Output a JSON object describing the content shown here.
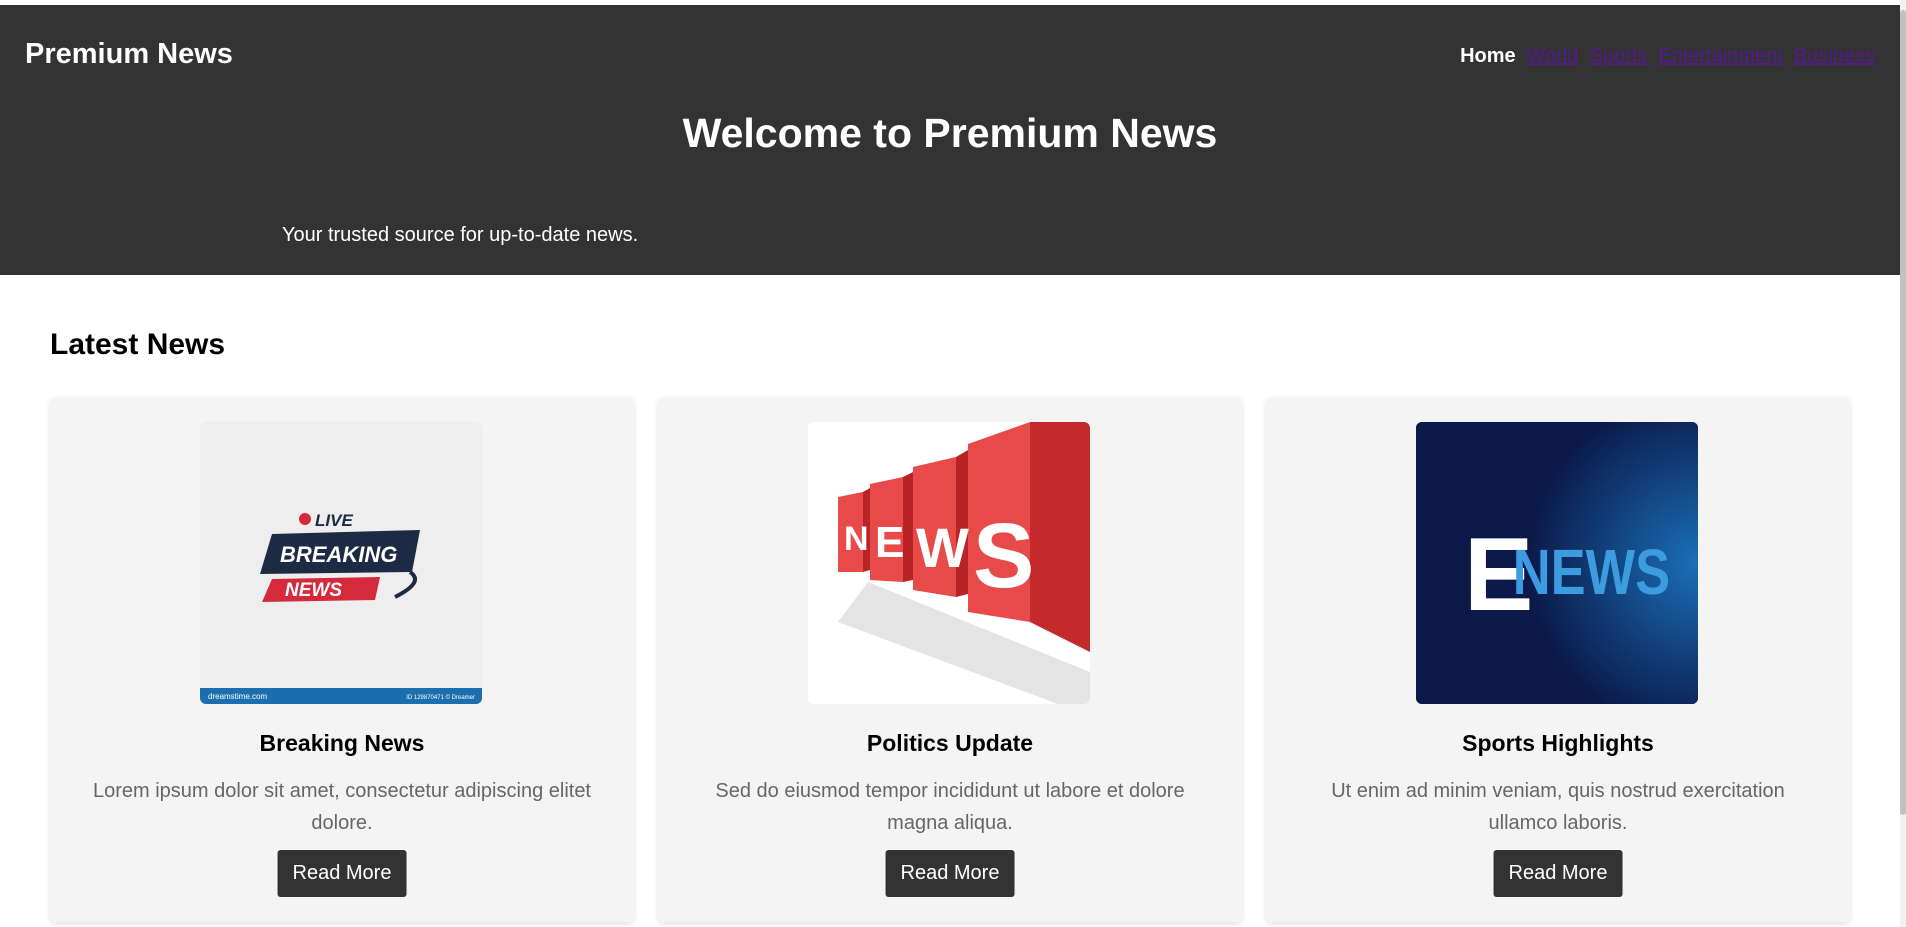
{
  "site": {
    "brand": "Premium News"
  },
  "nav": {
    "items": [
      {
        "label": "Home",
        "active": true
      },
      {
        "label": "World"
      },
      {
        "label": "Sports"
      },
      {
        "label": "Entertainment"
      },
      {
        "label": "Business"
      }
    ]
  },
  "hero": {
    "title": "Welcome to Premium News",
    "tagline": "Your trusted source for up-to-date news."
  },
  "main": {
    "section_title": "Latest News",
    "cards": [
      {
        "title": "Breaking News",
        "text": "Lorem ipsum dolor sit amet, consectetur adipiscing elitet dolore.",
        "button": "Read More",
        "image": {
          "icon": "live-breaking-news-logo",
          "live": "LIVE",
          "breaking": "BREAKING",
          "news": "NEWS",
          "footer_left": "dreamstime.com",
          "footer_right": "ID 129870471 © Dreamer"
        }
      },
      {
        "title": "Politics Update",
        "text": "Sed do eiusmod tempor incididunt ut labore et dolore magna aliqua.",
        "button": "Read More",
        "image": {
          "icon": "news-3d-blocks",
          "letters": [
            "N",
            "E",
            "W",
            "S"
          ]
        }
      },
      {
        "title": "Sports Highlights",
        "text": "Ut enim ad minim veniam, quis nostrud exercitation ullamco laboris.",
        "button": "Read More",
        "image": {
          "icon": "e-news-logo",
          "e": "E",
          "news": "NEWS"
        }
      }
    ]
  },
  "colors": {
    "header_bg": "#333333",
    "card_bg": "#f4f4f4",
    "button_bg": "#333333",
    "link_visited": "#551a8b",
    "accent_red": "#e0393e",
    "enews_blue": "#3d9be0",
    "enews_bg": "#0b1a4a"
  }
}
